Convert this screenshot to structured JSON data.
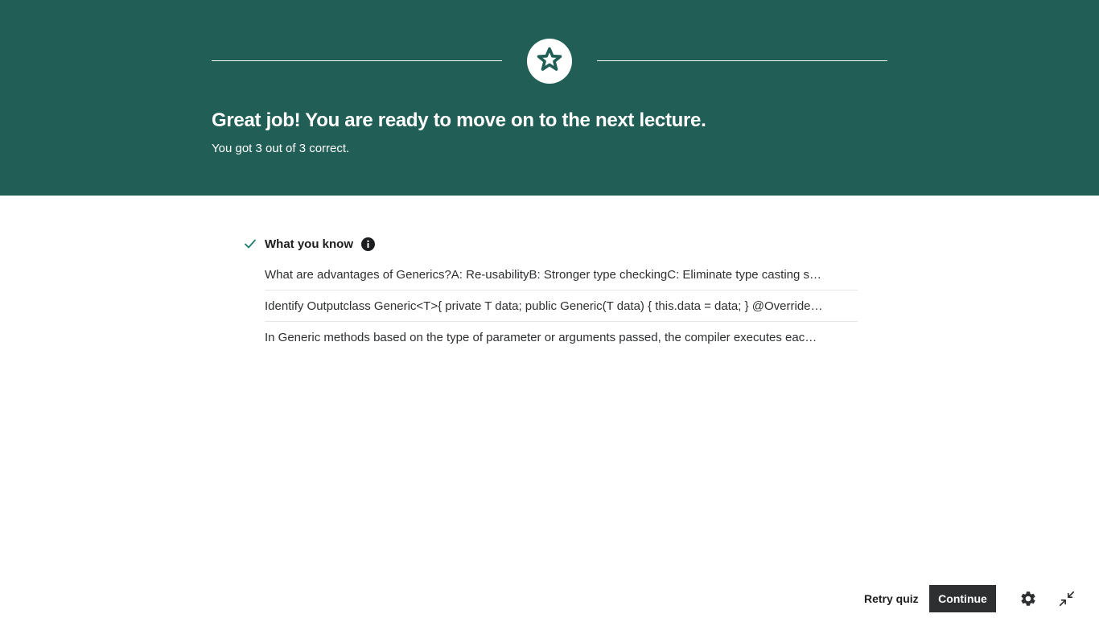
{
  "banner": {
    "headline": "Great job! You are ready to move on to the next lecture.",
    "score_text": "You got 3 out of 3 correct.",
    "badge_icon": "star-icon",
    "background_color": "#215f56"
  },
  "what_you_know": {
    "title": "What you know",
    "status_icon": "check-icon",
    "info_icon": "info-icon",
    "questions": [
      "What are advantages of Generics?A: Re-usabilityB: Stronger type checkingC: Eliminate type casting s…",
      "Identify Outputclass Generic<T>{ private T data; public Generic(T data) { this.data = data; } @Override…",
      "In Generic methods based on the type of parameter or arguments passed, the compiler executes eac…"
    ]
  },
  "footer": {
    "retry_label": "Retry quiz",
    "continue_label": "Continue",
    "settings_icon": "gear-icon",
    "exit_fullscreen_icon": "exit-fullscreen-icon"
  }
}
